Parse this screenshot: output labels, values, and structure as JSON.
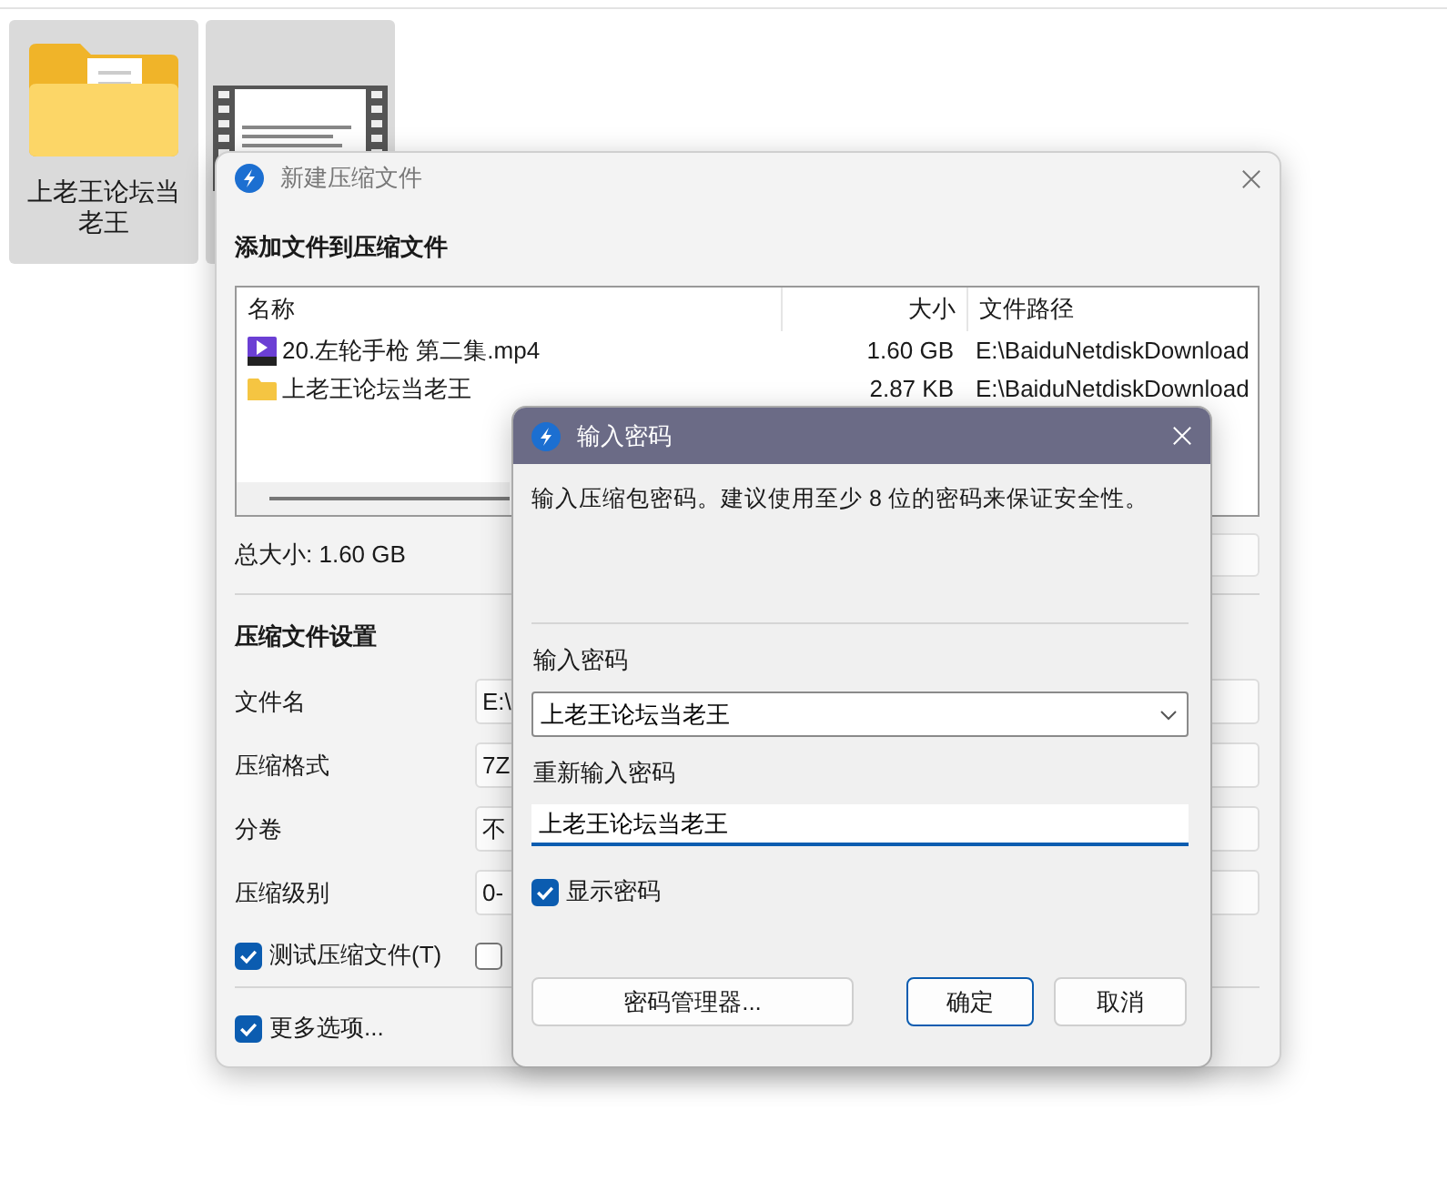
{
  "desktop": {
    "items": [
      {
        "kind": "folder",
        "label": "上老王论坛当老王",
        "selected": true
      },
      {
        "kind": "video",
        "selected": true
      }
    ]
  },
  "archive_dialog": {
    "title": "新建压缩文件",
    "heading": "添加文件到压缩文件",
    "table": {
      "columns": [
        "名称",
        "大小",
        "文件路径"
      ],
      "rows": [
        {
          "kind": "video",
          "name": "20.左轮手枪 第二集.mp4",
          "size": "1.60 GB",
          "path": "E:\\BaiduNetdiskDownload"
        },
        {
          "kind": "folder",
          "name": "上老王论坛当老王",
          "size": "2.87 KB",
          "path": "E:\\BaiduNetdiskDownload"
        }
      ]
    },
    "total": "总大小: 1.60 GB",
    "settings_heading": "压缩文件设置",
    "settings": [
      {
        "label": "文件名",
        "value": "E:\\"
      },
      {
        "label": "压缩格式",
        "value": "7Z"
      },
      {
        "label": "分卷",
        "value": "不"
      },
      {
        "label": "压缩级别",
        "value": "0-"
      }
    ],
    "options": [
      {
        "label": "测试压缩文件(T)",
        "checked": true
      },
      {
        "checked": false
      }
    ],
    "more_options": {
      "label": "更多选项...",
      "checked": true
    }
  },
  "password_dialog": {
    "title": "输入密码",
    "message": "输入压缩包密码。建议使用至少 8 位的密码来保证安全性。",
    "password_label": "输入密码",
    "password": "上老王论坛当老王",
    "confirm_label": "重新输入密码",
    "confirm": "上老王论坛当老王",
    "show_password": {
      "label": "显示密码",
      "checked": true
    },
    "buttons": [
      {
        "label": "密码管理器...",
        "default": false
      },
      {
        "label": "确定",
        "default": true
      },
      {
        "label": "取消",
        "default": false
      }
    ]
  }
}
